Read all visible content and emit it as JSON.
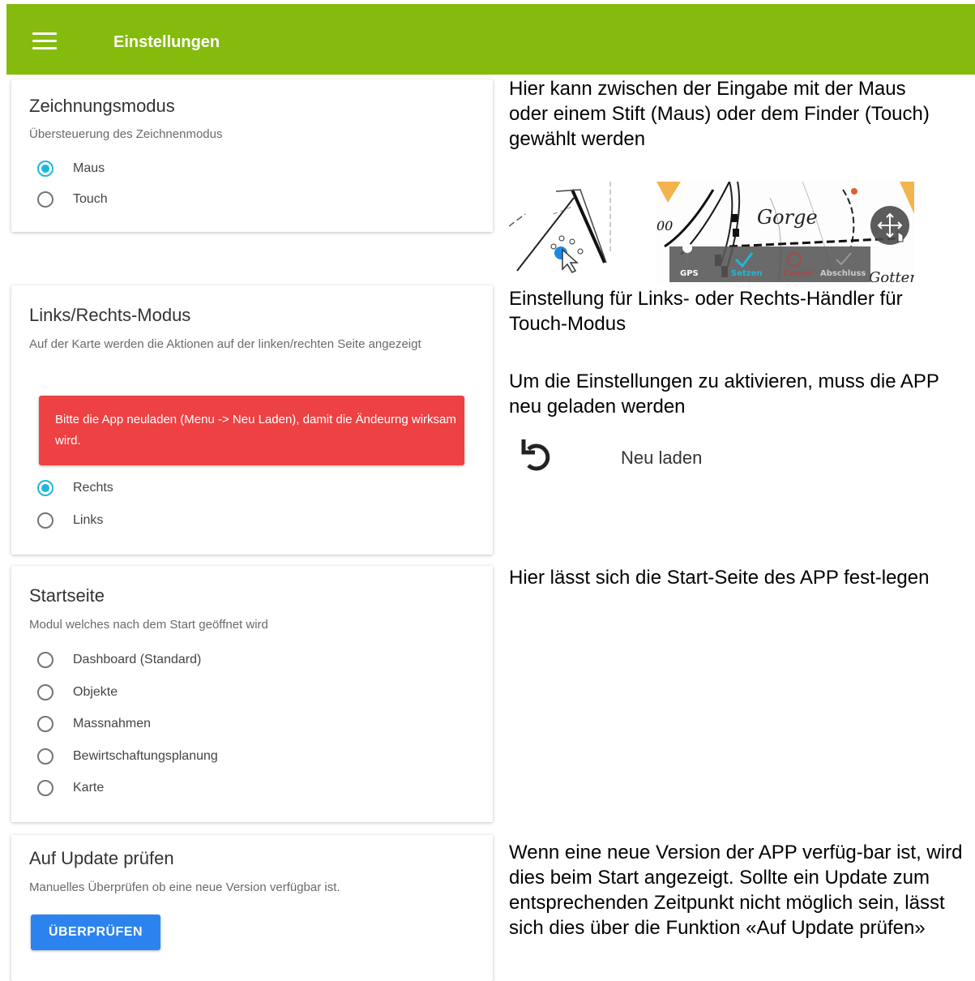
{
  "appbar": {
    "title": "Einstellungen"
  },
  "cards": {
    "drawing": {
      "title": "Zeichnungsmodus",
      "subtitle": "Übersteuerung des Zeichnenmodus",
      "options": [
        {
          "label": "Maus",
          "selected": true
        },
        {
          "label": "Touch",
          "selected": false
        }
      ]
    },
    "hand": {
      "title": "Links/Rechts-Modus",
      "subtitle": "Auf der Karte werden die Aktionen auf der linken/rechten Seite angezeigt",
      "alert": "Bitte die App neuladen (Menu -> Neu Laden), damit die Ändeurng wirksam wird.",
      "options": [
        {
          "label": "Rechts",
          "selected": true
        },
        {
          "label": "Links",
          "selected": false
        }
      ]
    },
    "start": {
      "title": "Startseite",
      "subtitle": "Modul welches nach dem Start geöffnet wird",
      "options": [
        {
          "label": "Dashboard (Standard)",
          "selected": false
        },
        {
          "label": "Objekte",
          "selected": false
        },
        {
          "label": "Massnahmen",
          "selected": false
        },
        {
          "label": "Bewirtschaftungsplanung",
          "selected": false
        },
        {
          "label": "Karte",
          "selected": false
        }
      ]
    },
    "update": {
      "title": "Auf Update prüfen",
      "subtitle": "Manuelles Überprüfen ob eine neue Version verfügbar ist.",
      "button": "ÜBERPRÜFEN"
    }
  },
  "notes": {
    "drawing": "Hier kann zwischen der Eingabe mit der Maus oder einem Stift (Maus) oder dem Finder (Touch) gewählt werden",
    "hand": "Einstellung für Links- oder Rechts-Händler für Touch-Modus",
    "reload_info": "Um die Einstellungen zu aktivieren, muss die APP neu geladen werden",
    "start": "Hier lässt sich die Start-Seite des APP fest-legen",
    "update": "Wenn eine neue Version der APP verfüg-bar ist, wird dies beim Start angezeigt. Sollte ein Update zum entsprechenden Zeitpunkt nicht möglich sein, lässt sich dies über die Funktion «Auf Update prüfen»"
  },
  "reload": {
    "label": "Neu laden",
    "icon": "undo-icon"
  },
  "map": {
    "place": "Gorge",
    "place2": "Gotter",
    "road_label": "00",
    "toolbar": {
      "gps": "GPS",
      "set": "Setzen",
      "cancel": "Cancel",
      "finish": "Abschluss"
    }
  },
  "colors": {
    "appbar": "#84bb0c",
    "radio_on": "#1fb7d9",
    "alert": "#ee4143",
    "button": "#2b84ee"
  }
}
